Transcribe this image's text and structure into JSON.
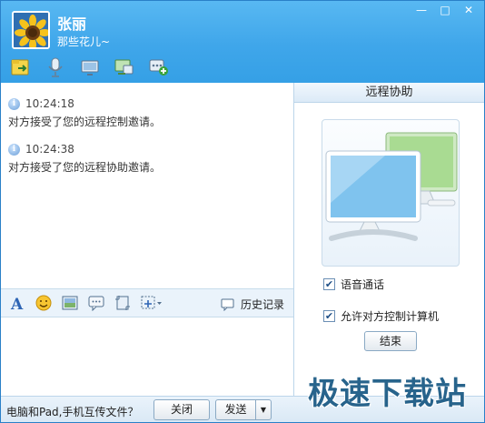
{
  "contact": {
    "name": "张丽",
    "signature": "那些花儿~"
  },
  "window_controls": {
    "minimize": "—",
    "maximize": "□",
    "close": "✕"
  },
  "toolbar": {
    "icons": [
      "file-transfer-icon",
      "voice-call-icon",
      "video-call-icon",
      "remote-desktop-icon",
      "more-apps-icon"
    ]
  },
  "messages": [
    {
      "time": "10:24:18",
      "text": "对方接受了您的远程控制邀请。"
    },
    {
      "time": "10:24:38",
      "text": "对方接受了您的远程协助邀请。"
    }
  ],
  "format_bar": {
    "icons": [
      "font-icon",
      "emoji-icon",
      "image-icon",
      "chat-bubble-icon",
      "screenshot-icon",
      "screen-capture-menu-icon"
    ],
    "history_label": "历史记录"
  },
  "remote_panel": {
    "title": "远程协助",
    "voice_call_label": "语音通话",
    "allow_control_label": "允许对方控制计算机",
    "voice_checked": true,
    "control_checked": true,
    "end_button": "结束"
  },
  "bottom": {
    "transfer_text": "电脑和Pad,手机互传文件？",
    "close_button": "关闭",
    "send_button": "发送",
    "send_dropdown": "▼"
  },
  "watermark": "极速下载站",
  "colors": {
    "header_blue": "#3fa6ea",
    "panel_border": "#bcd5ea",
    "watermark": "#1d5c86"
  }
}
